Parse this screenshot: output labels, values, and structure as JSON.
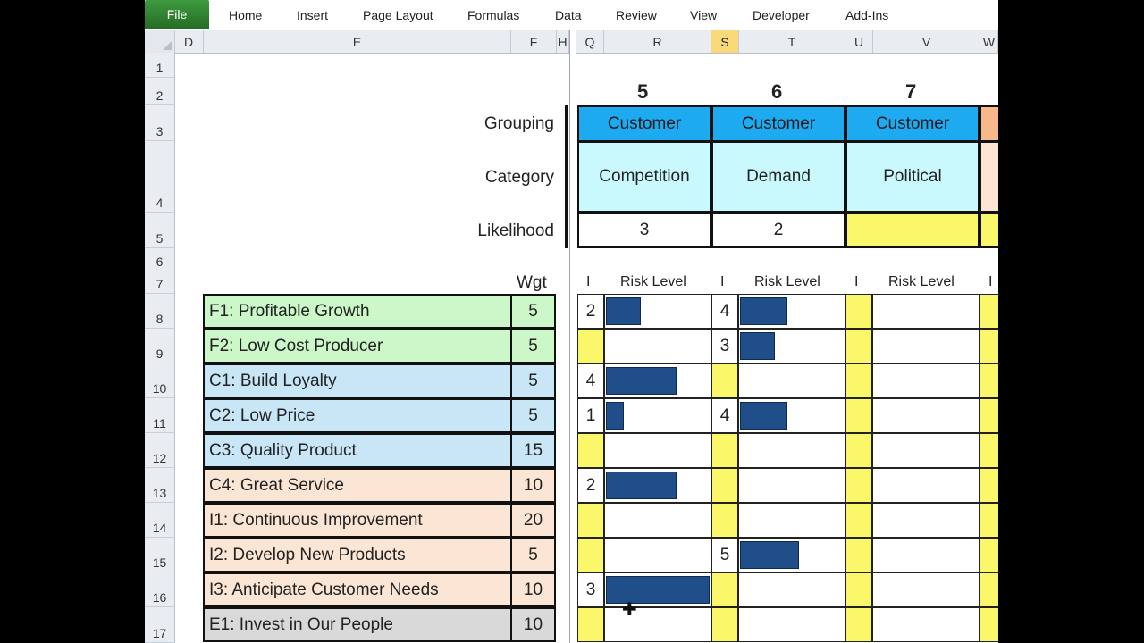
{
  "ribbon": {
    "file": "File",
    "tabs": [
      "Home",
      "Insert",
      "Page Layout",
      "Formulas",
      "Data",
      "Review",
      "View",
      "Developer",
      "Add-Ins"
    ]
  },
  "columns": [
    "D",
    "E",
    "F",
    "H",
    "Q",
    "R",
    "S",
    "T",
    "U",
    "V",
    "W"
  ],
  "rows": [
    "1",
    "2",
    "3",
    "4",
    "5",
    "6",
    "7",
    "8",
    "9",
    "10",
    "11",
    "12",
    "13",
    "14",
    "15",
    "16",
    "17"
  ],
  "labels": {
    "grouping": "Grouping",
    "category": "Category",
    "likelihood": "Likelihood",
    "wgt": "Wgt"
  },
  "objectives": [
    {
      "name": "F1: Profitable Growth",
      "wgt": "5",
      "color": "#ccf7c9"
    },
    {
      "name": "F2: Low Cost Producer",
      "wgt": "5",
      "color": "#ccf7c9"
    },
    {
      "name": "C1: Build Loyalty",
      "wgt": "5",
      "color": "#c9e6f7"
    },
    {
      "name": "C2: Low Price",
      "wgt": "5",
      "color": "#c9e6f7"
    },
    {
      "name": "C3: Quality Product",
      "wgt": "15",
      "color": "#c9e6f7"
    },
    {
      "name": "C4: Great Service",
      "wgt": "10",
      "color": "#fbe5d5"
    },
    {
      "name": "I1: Continuous Improvement",
      "wgt": "20",
      "color": "#fbe5d5"
    },
    {
      "name": "I2: Develop New Products",
      "wgt": "5",
      "color": "#fbe5d5"
    },
    {
      "name": "I3: Anticipate Customer Needs",
      "wgt": "10",
      "color": "#fbe5d5"
    },
    {
      "name": "E1: Invest in Our People",
      "wgt": "10",
      "color": "#d9d9d9"
    }
  ],
  "risks": [
    {
      "number": "5",
      "grouping": "Customer",
      "category": "Competition",
      "likelihood": "3",
      "impacts": [
        "2",
        "",
        "4",
        "1",
        "",
        "2",
        "",
        "",
        "3",
        ""
      ],
      "levels": [
        0.34,
        0,
        0.68,
        0.17,
        0,
        0.68,
        0,
        0,
        1.0,
        0
      ]
    },
    {
      "number": "6",
      "grouping": "Customer",
      "category": "Demand",
      "likelihood": "2",
      "impacts": [
        "4",
        "3",
        "",
        "4",
        "",
        "",
        "",
        "5",
        "",
        ""
      ],
      "levels": [
        0.46,
        0.34,
        0,
        0.46,
        0,
        0,
        0,
        0.57,
        0,
        0
      ]
    },
    {
      "number": "7",
      "grouping": "Customer",
      "category": "Political",
      "likelihood": "",
      "impacts": [
        "",
        "",
        "",
        "",
        "",
        "",
        "",
        "",
        "",
        ""
      ],
      "levels": [
        0,
        0,
        0,
        0,
        0,
        0,
        0,
        0,
        0,
        0
      ]
    }
  ],
  "subheaders": {
    "i": "I",
    "risk_level": "Risk Level"
  },
  "colors": {
    "grouping": "#1eaaf0",
    "category": "#c9f8fd",
    "empty_impact": "#fbf76a",
    "bar": "#1f4e88",
    "selected_col": "#f9d978"
  }
}
